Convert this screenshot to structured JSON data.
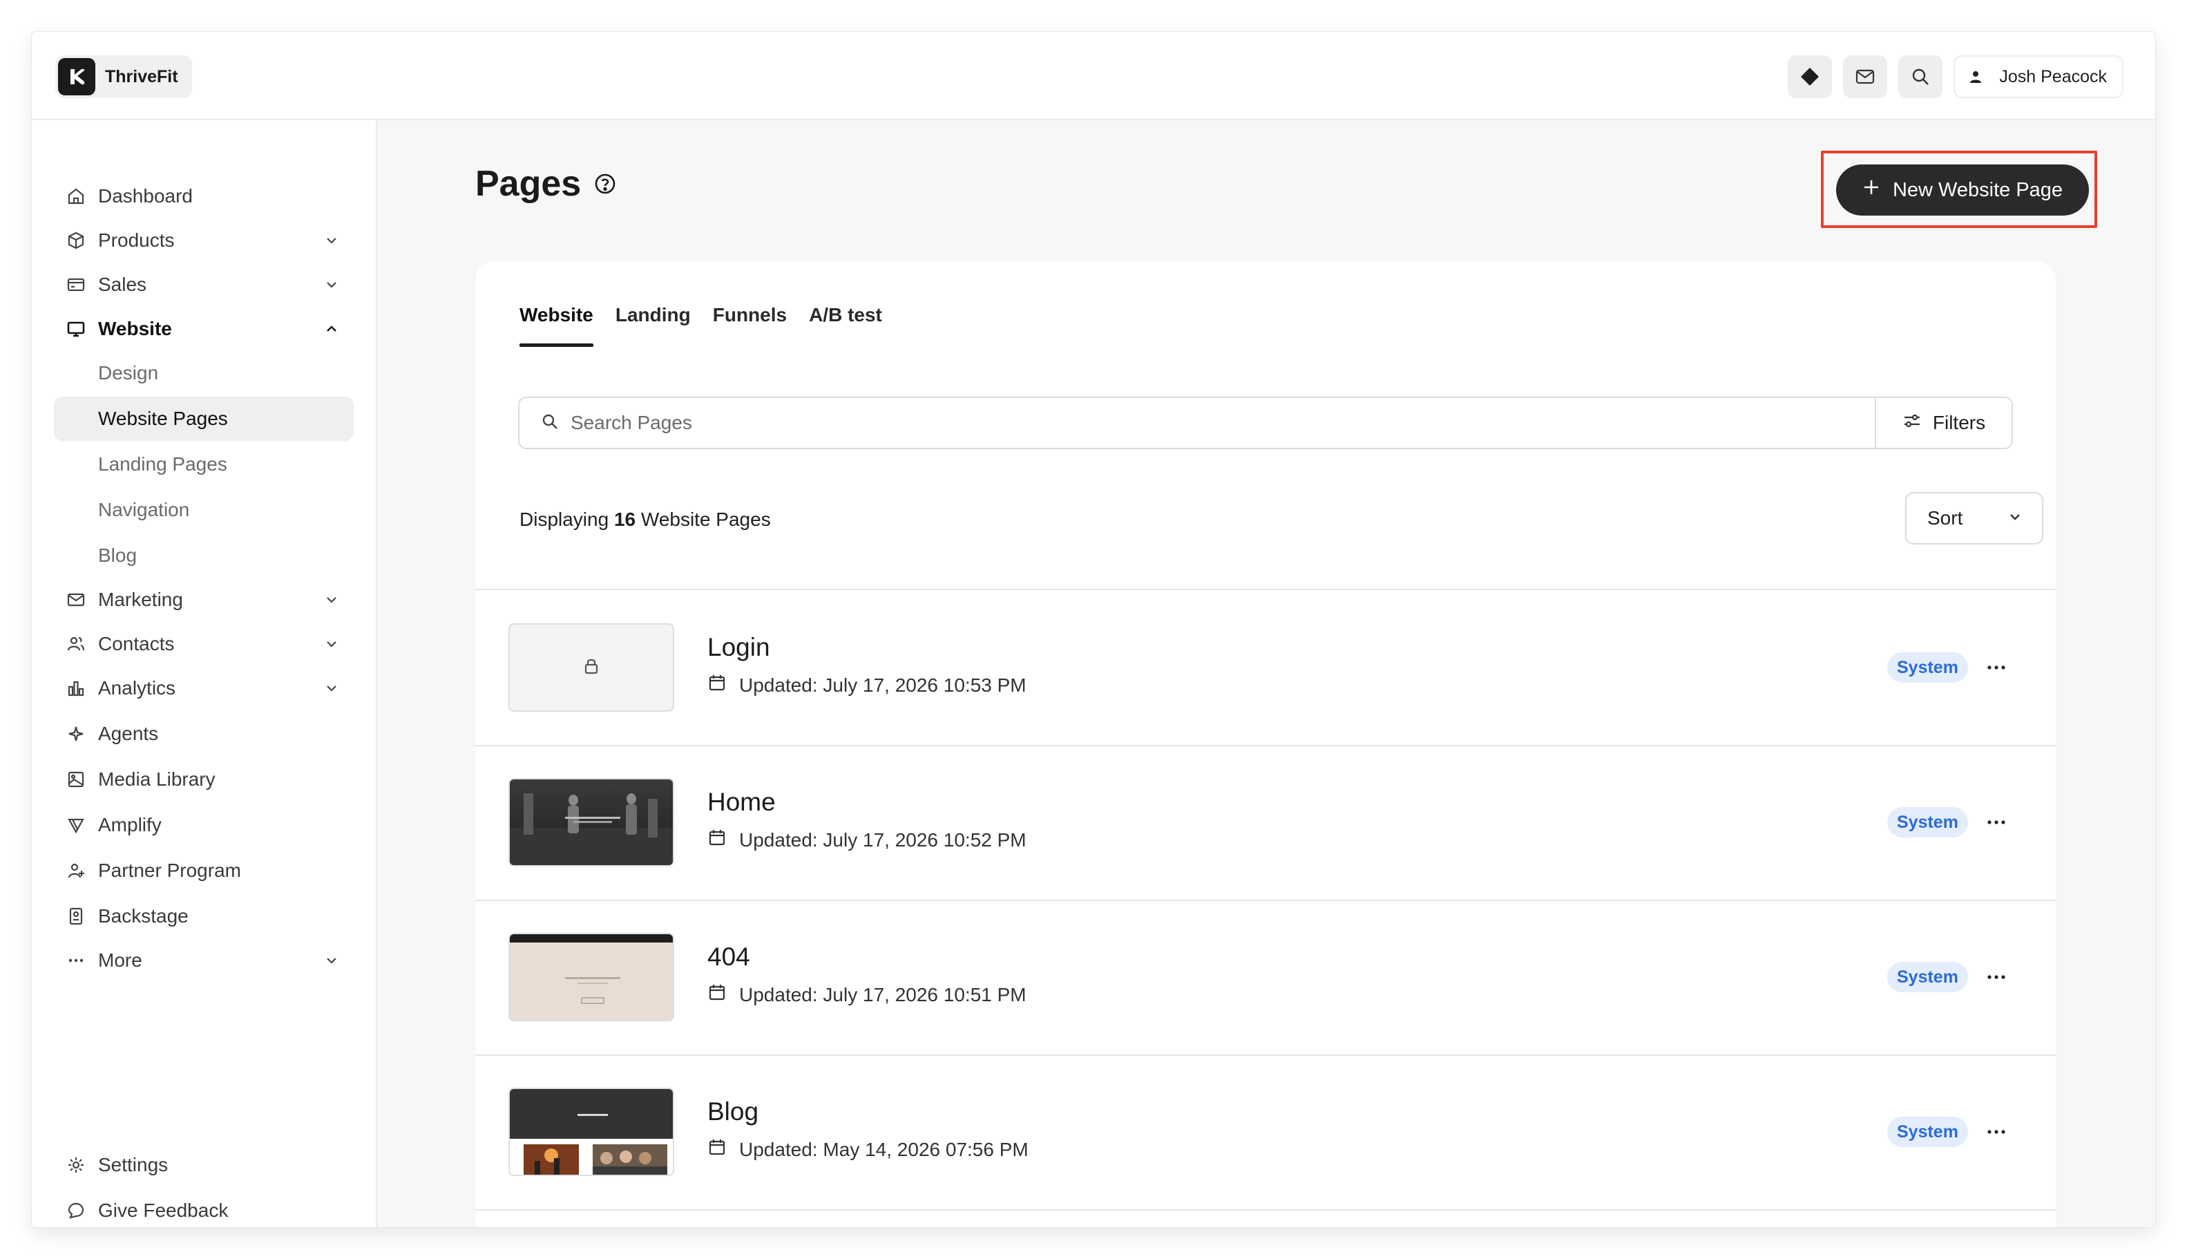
{
  "brand": {
    "name": "ThriveFit"
  },
  "topbar": {
    "icons": [
      "diamond-icon",
      "mail-icon",
      "search-icon"
    ],
    "user": {
      "name": "Josh Peacock"
    }
  },
  "sidebar": {
    "items": [
      {
        "label": "Dashboard",
        "icon": "home-icon"
      },
      {
        "label": "Products",
        "icon": "box-icon"
      },
      {
        "label": "Sales",
        "icon": "credit-card-icon"
      },
      {
        "label": "Website",
        "icon": "monitor-icon"
      },
      {
        "label": "Marketing",
        "icon": "mail-icon"
      },
      {
        "label": "Contacts",
        "icon": "users-icon"
      },
      {
        "label": "Analytics",
        "icon": "bar-chart-icon"
      },
      {
        "label": "Agents",
        "icon": "sparkle-icon"
      },
      {
        "label": "Media Library",
        "icon": "image-icon"
      },
      {
        "label": "Amplify",
        "icon": "megaphone-icon"
      },
      {
        "label": "Partner Program",
        "icon": "user-plus-icon"
      },
      {
        "label": "Backstage",
        "icon": "badge-icon"
      },
      {
        "label": "More",
        "icon": "ellipsis-icon"
      }
    ],
    "website_sub": [
      "Design",
      "Website Pages",
      "Landing Pages",
      "Navigation",
      "Blog"
    ],
    "footer": [
      {
        "label": "Settings",
        "icon": "gear-icon"
      },
      {
        "label": "Give Feedback",
        "icon": "chat-icon"
      }
    ]
  },
  "main": {
    "title": "Pages",
    "new_button": "New Website Page",
    "tabs": [
      "Website",
      "Landing",
      "Funnels",
      "A/B test"
    ],
    "search_placeholder": "Search Pages",
    "filters_label": "Filters",
    "display": {
      "prefix": "Displaying",
      "count": "16",
      "suffix": "Website Pages"
    },
    "sort_label": "Sort",
    "pages": [
      {
        "title": "Login",
        "updated": "Updated: July 17, 2026 10:53 PM",
        "badge": "System"
      },
      {
        "title": "Home",
        "updated": "Updated: July 17, 2026 10:52 PM",
        "badge": "System"
      },
      {
        "title": "404",
        "updated": "Updated: July 17, 2026 10:51 PM",
        "badge": "System"
      },
      {
        "title": "Blog",
        "updated": "Updated: May 14, 2026 07:56 PM",
        "badge": "System"
      }
    ]
  },
  "colors": {
    "accent": "#2a2a2a",
    "highlight": "#e8402b",
    "badge_bg": "#e3edfb",
    "badge_text": "#2c6ad8"
  }
}
